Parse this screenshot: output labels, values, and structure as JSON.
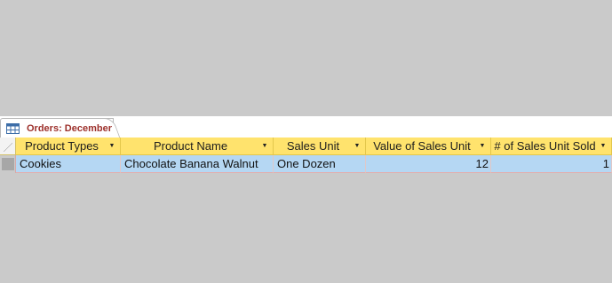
{
  "tab": {
    "label": "Orders: December",
    "icon": "table-icon"
  },
  "columns": [
    {
      "label": "Product Types"
    },
    {
      "label": "Product Name"
    },
    {
      "label": "Sales Unit"
    },
    {
      "label": "Value of Sales Unit"
    },
    {
      "label": "# of Sales Unit Sold"
    }
  ],
  "rows": [
    {
      "product_type": "Cookies",
      "product_name": "Chocolate Banana Walnut",
      "sales_unit": "One Dozen",
      "value": "12",
      "sold": "1"
    }
  ],
  "colors": {
    "header": "#ffe36d",
    "selected_row": "#b5d7f3",
    "tab_text": "#9c2f2a",
    "background": "#cacaca"
  }
}
